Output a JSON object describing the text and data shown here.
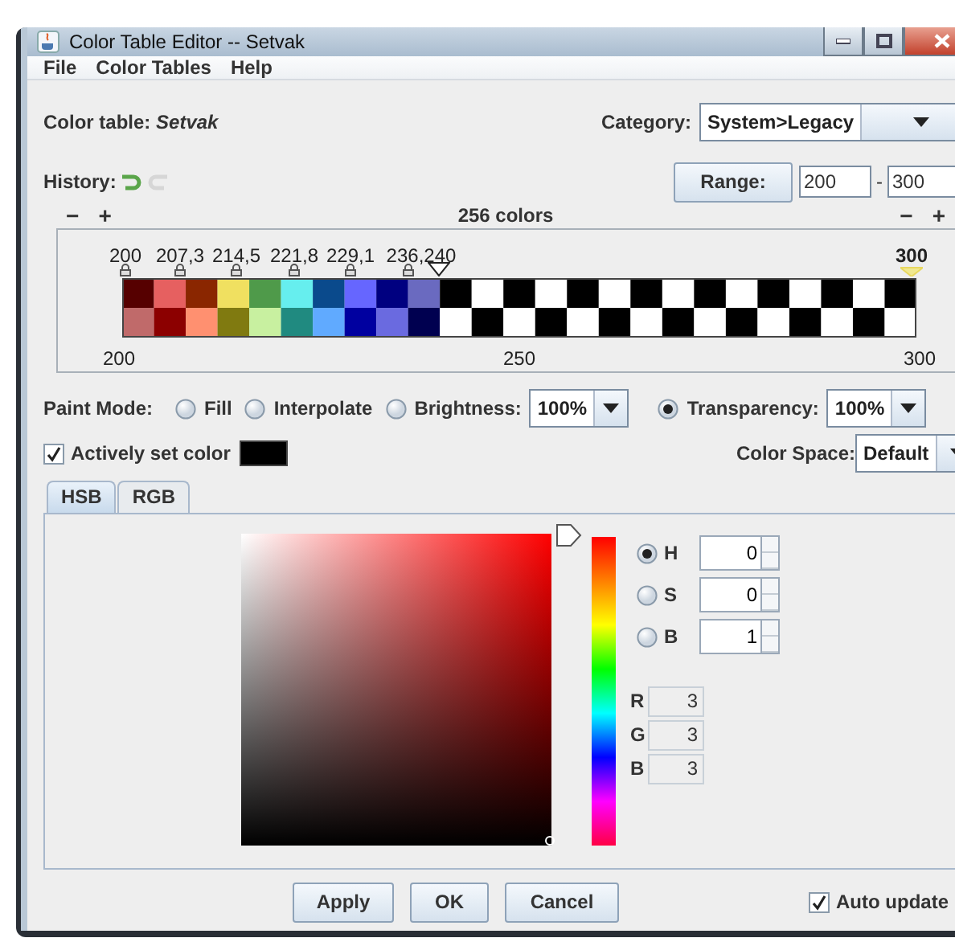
{
  "window": {
    "title": "Color Table Editor -- Setvak"
  },
  "menu": [
    "File",
    "Color Tables",
    "Help"
  ],
  "color_table": {
    "label": "Color table:",
    "name": "Setvak"
  },
  "category": {
    "label": "Category:",
    "value": "System>Legacy"
  },
  "history": {
    "label": "History:",
    "undo_enabled": true,
    "redo_enabled": false
  },
  "range": {
    "button": "Range:",
    "from": "200",
    "separator": "-",
    "to": "300"
  },
  "colors_count": "256 colors",
  "zoom_left": [
    "−",
    "+"
  ],
  "zoom_right": [
    "−",
    "+"
  ],
  "scale": {
    "markers": [
      {
        "label": "200",
        "kind": "lock"
      },
      {
        "label": "207,3",
        "kind": "lock"
      },
      {
        "label": "214,5",
        "kind": "lock"
      },
      {
        "label": "221,8",
        "kind": "lock"
      },
      {
        "label": "229,1",
        "kind": "lock"
      },
      {
        "label": "236,240",
        "kind": "lock"
      },
      {
        "label": "300",
        "kind": "end"
      }
    ],
    "axis": [
      "200",
      "250",
      "300"
    ]
  },
  "paint_mode": {
    "label": "Paint Mode:",
    "options": [
      {
        "label": "Fill",
        "selected": false
      },
      {
        "label": "Interpolate",
        "selected": false
      },
      {
        "label": "Brightness:",
        "selected": false,
        "value": "100%"
      },
      {
        "label": "Transparency:",
        "selected": true,
        "value": "100%"
      }
    ]
  },
  "actively_set_color": {
    "label": "Actively set color",
    "checked": true,
    "color": "#000000"
  },
  "color_space": {
    "label": "Color Space:",
    "value": "Default"
  },
  "tabs": [
    {
      "label": "HSB",
      "selected": true
    },
    {
      "label": "RGB",
      "selected": false
    }
  ],
  "hsb_fields": [
    {
      "label": "H",
      "selected": true,
      "value": "0"
    },
    {
      "label": "S",
      "selected": false,
      "value": "0"
    },
    {
      "label": "B",
      "selected": false,
      "value": "1"
    }
  ],
  "rgb_readout": [
    {
      "label": "R",
      "value": "3"
    },
    {
      "label": "G",
      "value": "3"
    },
    {
      "label": "B",
      "value": "3"
    }
  ],
  "buttons": [
    "Apply",
    "OK",
    "Cancel"
  ],
  "auto_update": {
    "label": "Auto update",
    "checked": true
  }
}
